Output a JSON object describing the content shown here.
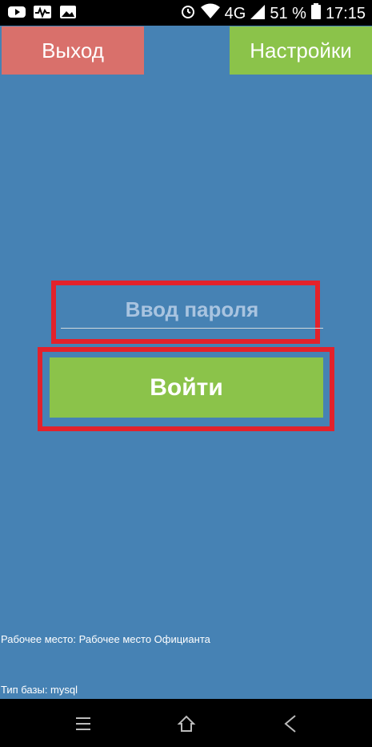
{
  "status_bar": {
    "network": "4G",
    "battery": "51 %",
    "time": "17:15",
    "icons": [
      "youtube-icon",
      "activity-icon",
      "image-icon",
      "alarm-icon",
      "wifi-icon",
      "signal-icon",
      "battery-icon"
    ]
  },
  "header": {
    "exit_label": "Выход",
    "settings_label": "Настройки"
  },
  "login": {
    "password_placeholder": "Ввод пароля",
    "submit_label": "Войти"
  },
  "footer_info": {
    "workplace": "Рабочее место: Рабочее место Официанта",
    "db_type": "Тип базы: mysql"
  },
  "nav": {
    "icons": [
      "menu-icon",
      "home-icon",
      "back-icon"
    ]
  },
  "colors": {
    "background": "#4682b4",
    "exit": "#d9706b",
    "accent_green": "#8bc34a",
    "highlight": "#e3222b"
  }
}
